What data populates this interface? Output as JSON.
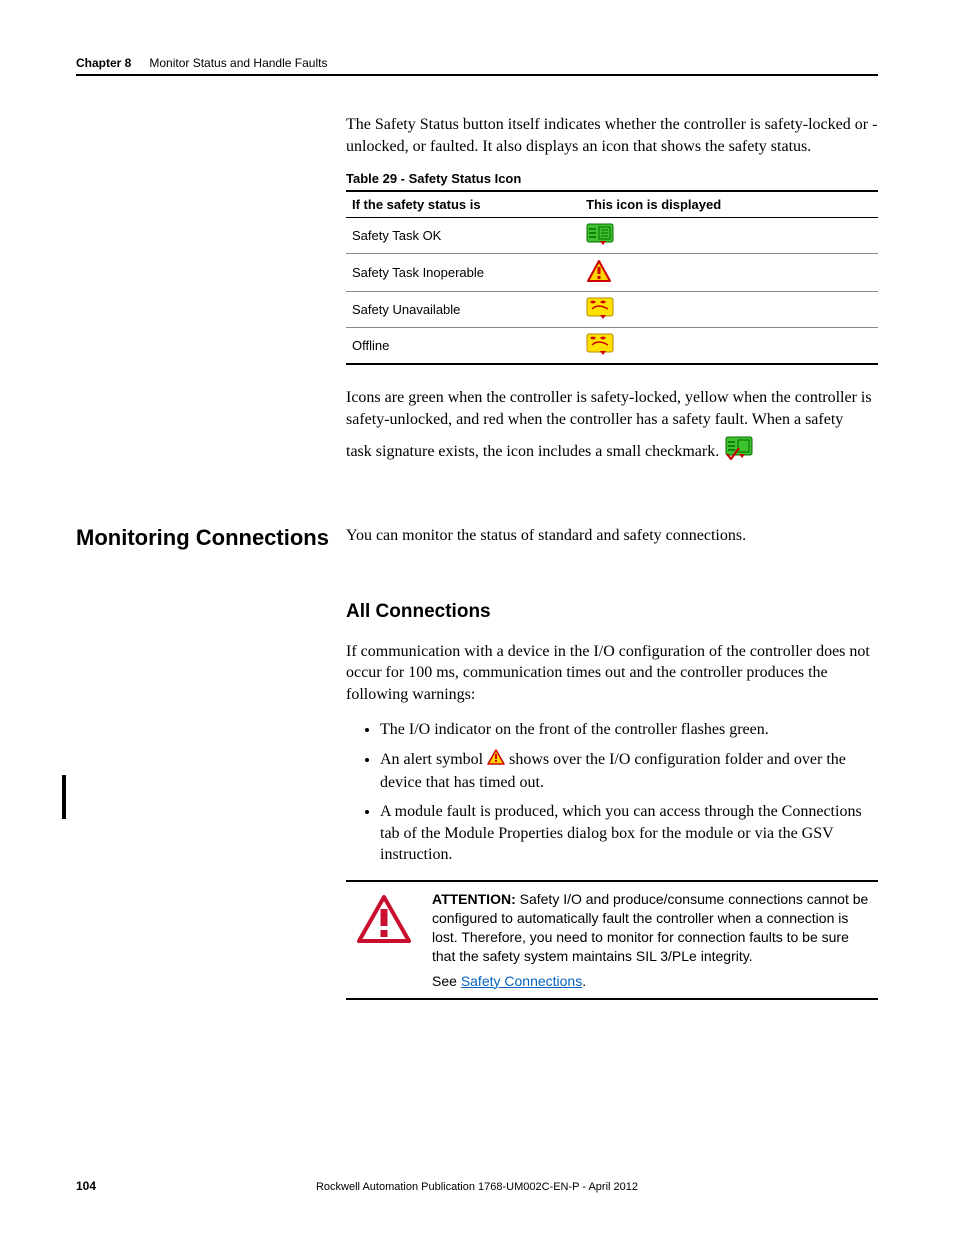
{
  "header": {
    "chapter_label": "Chapter 8",
    "chapter_title": "Monitor Status and Handle Faults"
  },
  "intro_para": "The Safety Status button itself indicates whether the controller is safety-locked or -unlocked, or faulted. It also displays an icon that shows the safety status.",
  "table": {
    "caption": "Table 29 - Safety Status Icon",
    "head_status": "If the safety status is",
    "head_icon": "This icon is displayed",
    "rows": [
      {
        "status": "Safety Task OK"
      },
      {
        "status": "Safety Task Inoperable"
      },
      {
        "status": "Safety Unavailable"
      },
      {
        "status": "Offline"
      }
    ]
  },
  "after_table_para_1": "Icons are green when the controller is safety-locked, yellow when the controller is safety-unlocked, and red when the controller has a safety fault. When a safety",
  "after_table_para_2": "task signature exists, the icon includes a small checkmark.",
  "section": {
    "side_heading": "Monitoring Connections",
    "lead_para": "You can monitor the status of standard and safety connections.",
    "sub_heading": "All Connections",
    "body_para": "If communication with a device in the I/O configuration of the controller does not occur for 100 ms, communication times out and the controller produces the following warnings:",
    "bullets": {
      "b1": "The I/O indicator on the front of the controller flashes green.",
      "b2a": "An alert symbol",
      "b2b": "shows over the I/O configuration folder and over the device that has timed out.",
      "b3": "A module fault is produced, which you can access through the Connections tab of the Module Properties dialog box for the module or via the GSV instruction."
    },
    "attention": {
      "label": "ATTENTION:",
      "text": " Safety I/O and produce/consume connections cannot be configured to automatically fault the controller when a connection is lost. Therefore, you need to monitor for connection faults to be sure that the safety system maintains SIL 3/PLe integrity.",
      "see_prefix": "See ",
      "see_link": "Safety Connections",
      "see_suffix": "."
    }
  },
  "footer": {
    "page_num": "104",
    "pub": "Rockwell Automation Publication 1768-UM002C-EN-P - April 2012"
  },
  "icons": {
    "ok": "safety-ok-icon",
    "inop": "safety-inoperable-icon",
    "unavail": "safety-unavailable-icon",
    "offline": "safety-offline-icon",
    "check": "safety-check-icon",
    "alert": "alert-icon",
    "attention": "attention-triangle-icon"
  }
}
